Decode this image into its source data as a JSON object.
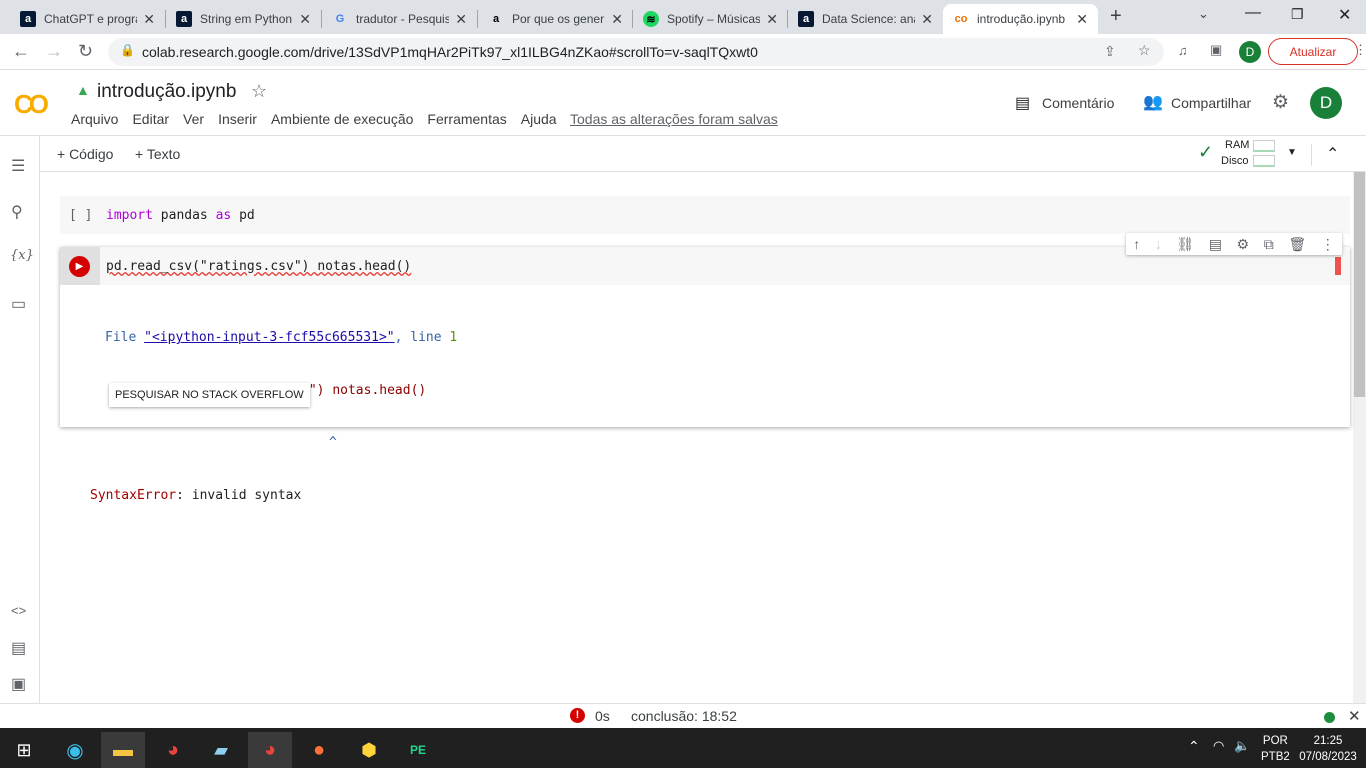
{
  "browser": {
    "tabs": [
      {
        "title": "ChatGPT e progra",
        "icon": "alura-icon",
        "color": "#051933"
      },
      {
        "title": "String em Python",
        "icon": "alura-icon",
        "color": "#051933"
      },
      {
        "title": "tradutor - Pesquis",
        "icon": "google-icon",
        "color": "#4285f4"
      },
      {
        "title": "Por que os gener",
        "icon": "amazon-icon",
        "color": "#ffffff"
      },
      {
        "title": "Spotify – Músicas",
        "icon": "spotify-icon",
        "color": "#1ed760"
      },
      {
        "title": "Data Science: ana",
        "icon": "alura-icon",
        "color": "#051933"
      },
      {
        "title": "introdução.ipynb",
        "icon": "colab-icon",
        "color": "#e8710a"
      }
    ],
    "url": "colab.research.google.com/drive/13SdVP1mqHAr2PiTk97_xl1ILBG4nZKao#scrollTo=v-saqlTQxwt0",
    "update_label": "Atualizar",
    "profile_initial": "D"
  },
  "colab": {
    "filename": "introdução.ipynb",
    "menu": [
      "Arquivo",
      "Editar",
      "Ver",
      "Inserir",
      "Ambiente de execução",
      "Ferramentas",
      "Ajuda"
    ],
    "saved_status": "Todas as alterações foram salvas",
    "comment_label": "Comentário",
    "share_label": "Compartilhar",
    "avatar_initial": "D",
    "add_code": "+ Código",
    "add_text": "+ Texto",
    "ram_label": "RAM",
    "disk_label": "Disco"
  },
  "cells": [
    {
      "bracket": "[ ]",
      "code": {
        "kw1": "import",
        "mid": " pandas ",
        "kw2": "as",
        "end": " pd"
      }
    },
    {
      "code": "pd.read_csv(\"ratings.csv\") notas.head()",
      "output": {
        "file_prefix": "File ",
        "file_link": "\"<ipython-input-3-fcf55c665531>\"",
        "line_text": ", line ",
        "line_no": "1",
        "code_line": "pd.read_csv(\"ratings.csv\") notas.head()",
        "caret": "^",
        "error_name": "SyntaxError",
        "error_msg": ": invalid syntax",
        "so_button": "PESQUISAR NO STACK OVERFLOW"
      }
    }
  ],
  "statusbar": {
    "time": "0s",
    "completion": "conclusão: 18:52",
    "error_color": "#d50000"
  },
  "taskbar": {
    "lang": "POR",
    "layout": "PTB2",
    "time": "21:25",
    "date": "07/08/2023"
  }
}
